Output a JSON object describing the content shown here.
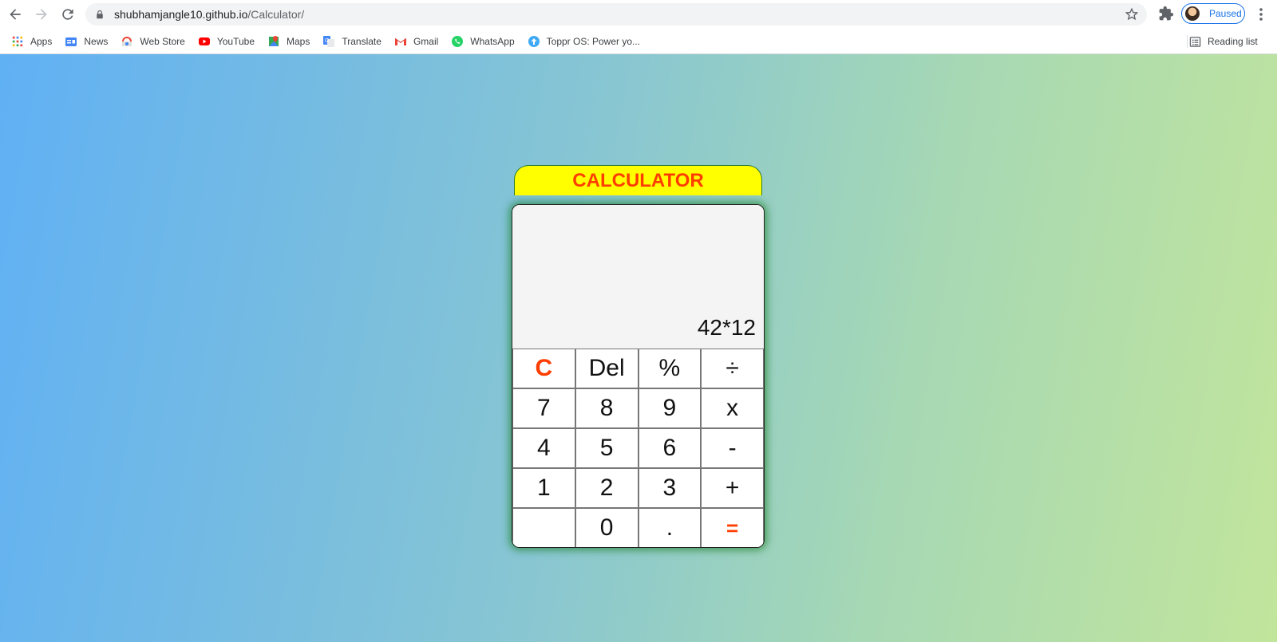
{
  "browser": {
    "url_host": "shubhamjangle10.github.io",
    "url_path": "/Calculator/",
    "profile_label": "Paused",
    "reading_list_label": "Reading list",
    "bookmarks": [
      {
        "label": "Apps",
        "icon": "apps-grid-icon"
      },
      {
        "label": "News",
        "icon": "google-news-icon"
      },
      {
        "label": "Web Store",
        "icon": "web-store-icon"
      },
      {
        "label": "YouTube",
        "icon": "youtube-icon"
      },
      {
        "label": "Maps",
        "icon": "maps-icon"
      },
      {
        "label": "Translate",
        "icon": "translate-icon"
      },
      {
        "label": "Gmail",
        "icon": "gmail-icon"
      },
      {
        "label": "WhatsApp",
        "icon": "whatsapp-icon"
      },
      {
        "label": "Toppr OS: Power yo...",
        "icon": "toppr-icon"
      }
    ]
  },
  "calculator": {
    "title": "CALCULATOR",
    "display": "42*12",
    "keys": [
      [
        "C",
        "Del",
        "%",
        "÷"
      ],
      [
        "7",
        "8",
        "9",
        "x"
      ],
      [
        "4",
        "5",
        "6",
        "-"
      ],
      [
        "1",
        "2",
        "3",
        "+"
      ],
      [
        "",
        "0",
        ".",
        "="
      ]
    ]
  },
  "colors": {
    "title_bg": "#ffff00",
    "accent_red": "#ff3d00",
    "gradient_start": "#60b0f4",
    "gradient_end": "#c2e59c"
  }
}
